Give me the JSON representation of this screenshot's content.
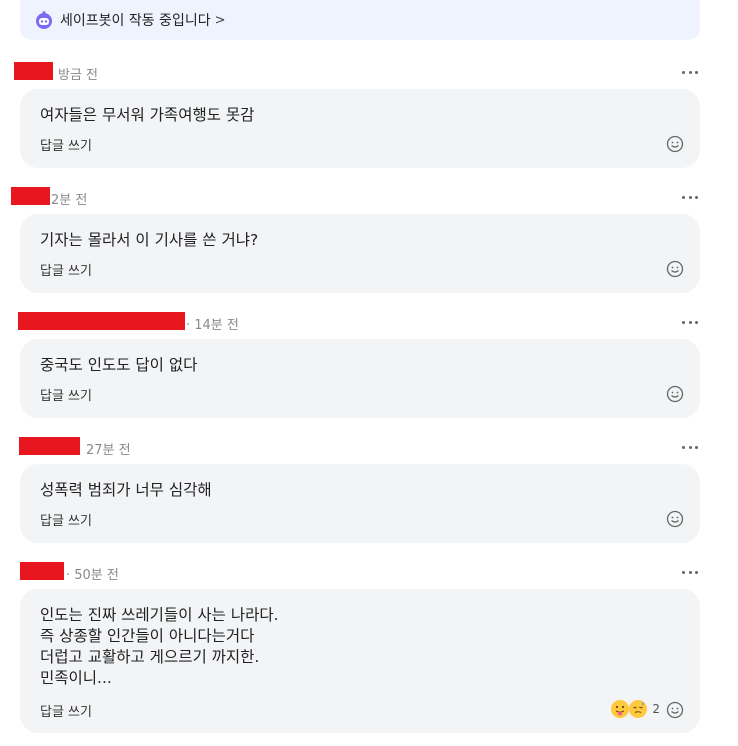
{
  "banner": {
    "text": "세이프봇이 작동 중입니다",
    "chevron": ">"
  },
  "reply_label": "답글 쓰기",
  "comments": [
    {
      "time": "방금 전",
      "text": "여자들은 무서워 가족여행도 못감"
    },
    {
      "time": "2분 전",
      "text": "기자는 몰라서 이 기사를 쓴 거냐?"
    },
    {
      "time": "· 14분 전",
      "text": "중국도 인도도 답이 없다"
    },
    {
      "time": "27분 전",
      "text": "성폭력 범죄가 너무 심각해"
    },
    {
      "time": "· 50분 전",
      "text": "인도는 진짜 쓰레기들이 사는 나라다.\n즉 상종할 인간들이 아니다는거다\n더럽고 교활하고 게으르기 까지한.\n민족이니...",
      "reaction_count": "2"
    }
  ],
  "icons": {
    "bot": "robot-icon",
    "more": "more-horizontal-icon",
    "smiley": "smiley-icon",
    "reaction1": "tongue-emoji-icon",
    "reaction2": "sleepy-emoji-icon"
  },
  "colors": {
    "redaction": "#e8171f",
    "bubble": "#f3f4f6",
    "banner": "#eef3fd"
  }
}
